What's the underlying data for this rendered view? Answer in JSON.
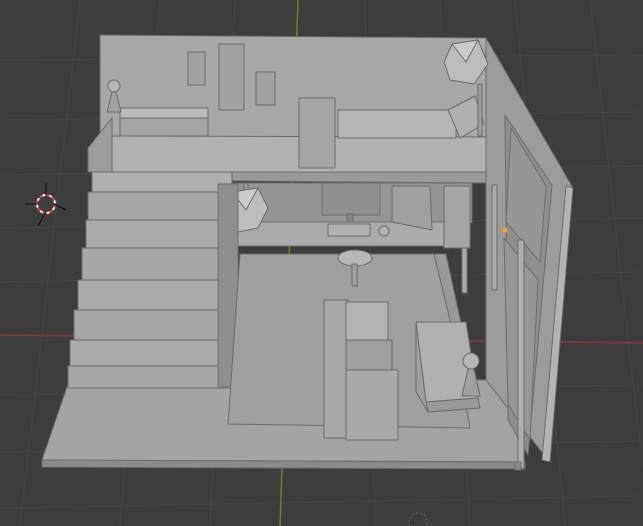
{
  "app": "3D viewport",
  "colors": {
    "background": "#3d3d3d",
    "grid_line": "#474747",
    "axis_x": "#8a3a3e",
    "axis_y": "#5d8a22",
    "model_light": "#a9a9a9",
    "model_mid": "#959595",
    "model_dark": "#7f7f7f",
    "outline": "#6a6a6a",
    "selection_origin": "#f0a030"
  },
  "icons": {
    "cursor": "3d-cursor-icon"
  }
}
